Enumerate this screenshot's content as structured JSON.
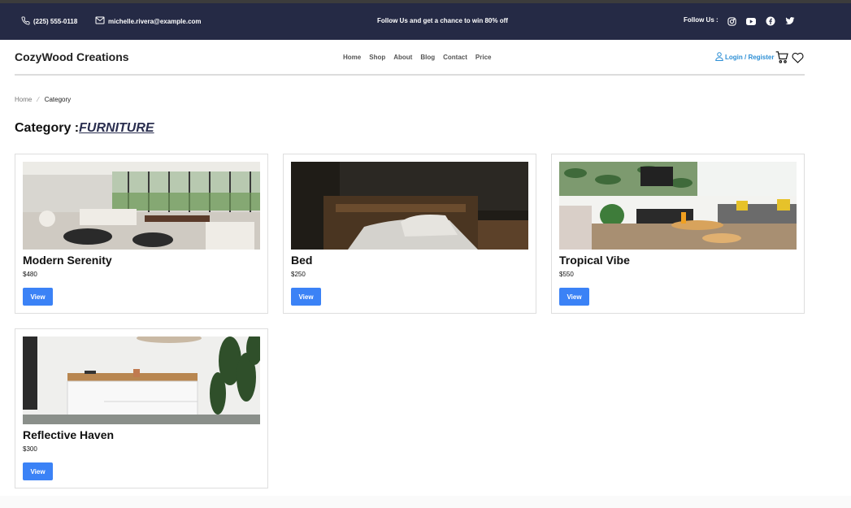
{
  "topbar": {
    "phone": "(225) 555-0118",
    "email": "michelle.rivera@example.com",
    "promo": "Follow Us and get a chance to win 80% off",
    "follow_label": "Follow Us :",
    "socials": [
      "instagram-icon",
      "youtube-icon",
      "facebook-icon",
      "twitter-icon"
    ]
  },
  "header": {
    "brand": "CozyWood Creations",
    "nav": [
      "Home",
      "Shop",
      "About",
      "Blog",
      "Contact",
      "Price"
    ],
    "login": "Login / Register"
  },
  "breadcrumb": {
    "home": "Home",
    "current": "Category"
  },
  "category": {
    "label": "Category :",
    "name": "FURNITURE"
  },
  "products": [
    {
      "name": "Modern Serenity",
      "price": "$480",
      "button": "View"
    },
    {
      "name": "Bed",
      "price": "$250",
      "button": "View"
    },
    {
      "name": "Tropical Vibe",
      "price": "$550",
      "button": "View"
    },
    {
      "name": "Reflective Haven",
      "price": "$300",
      "button": "View"
    }
  ],
  "colors": {
    "topbar_bg": "#252a45",
    "accent_blue": "#3b82f6",
    "login_blue": "#2d8fd5"
  }
}
